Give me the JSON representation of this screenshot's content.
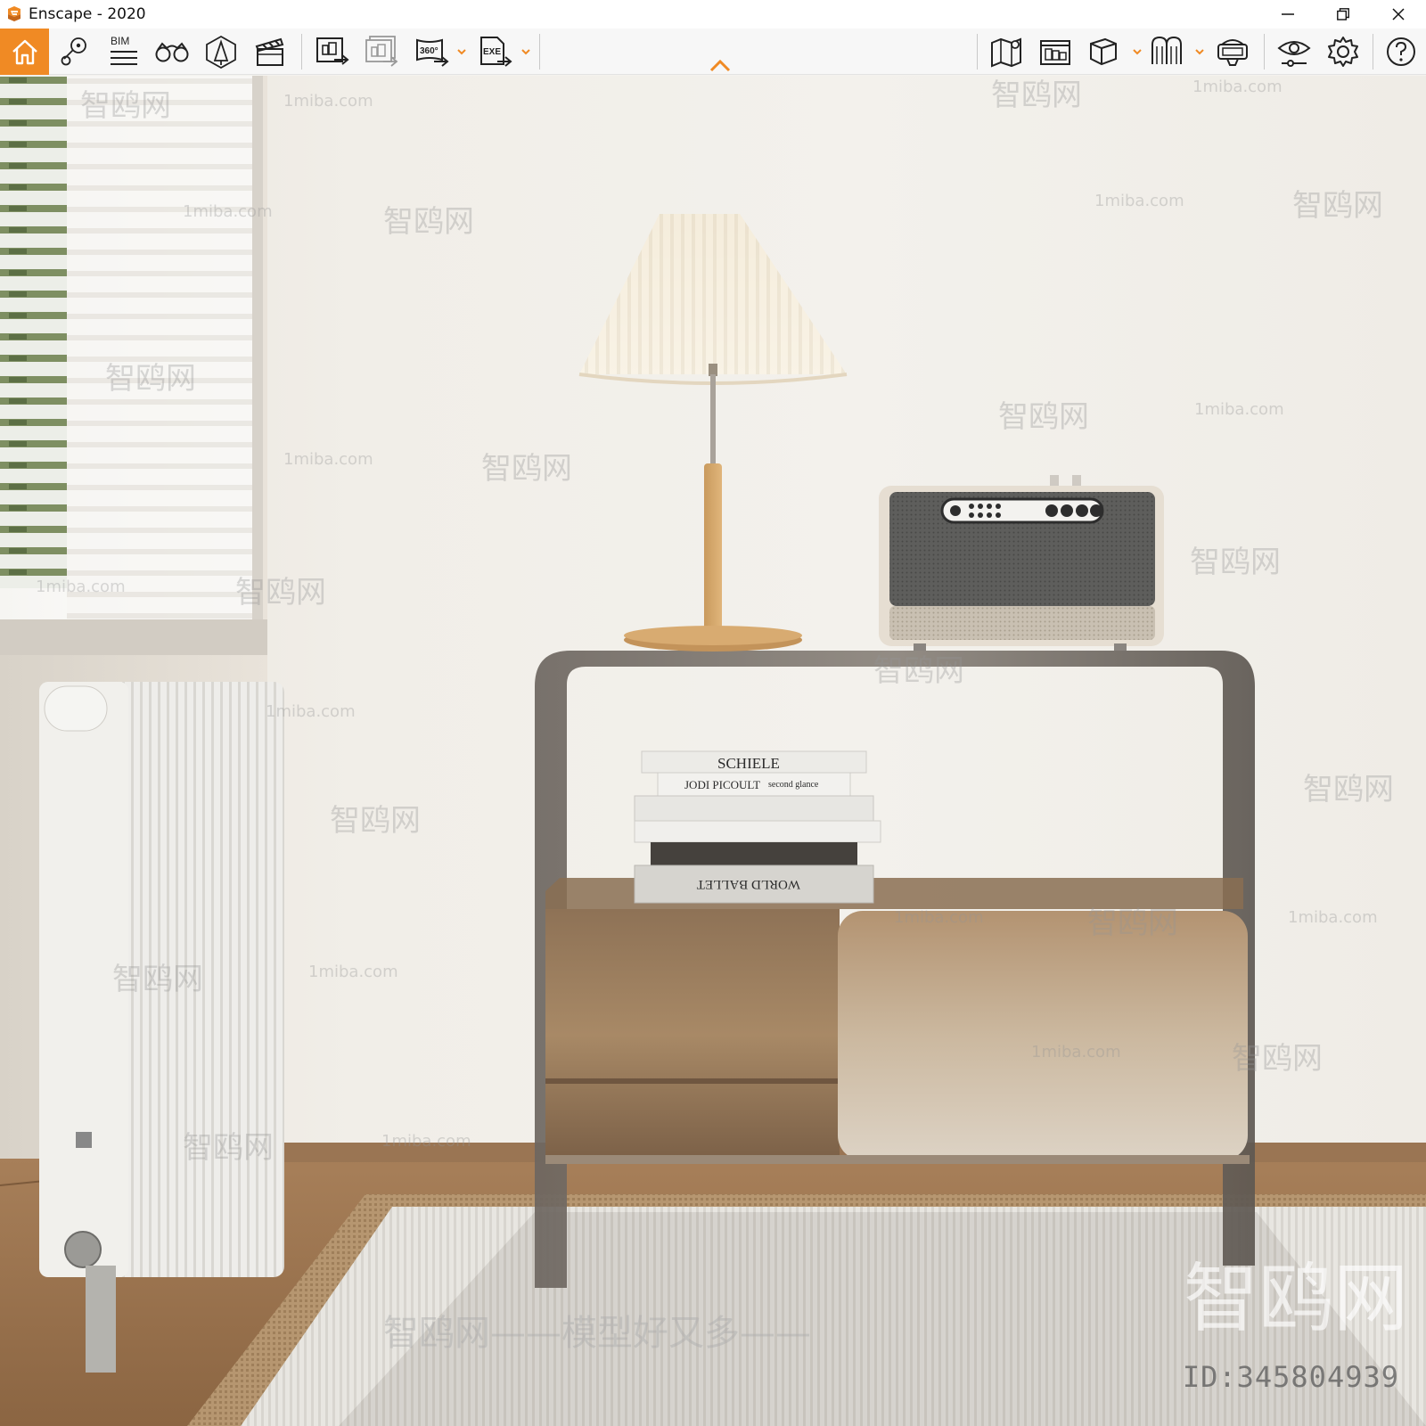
{
  "window": {
    "title": "Enscape - 2020",
    "controls": [
      "minimize",
      "restore",
      "close"
    ]
  },
  "toolbar": {
    "left_tools": [
      {
        "name": "home",
        "icon": "home-icon",
        "active": true
      },
      {
        "name": "views",
        "icon": "map-pin-views-icon"
      },
      {
        "name": "bim",
        "icon": "bim-list-icon",
        "label": "BIM"
      },
      {
        "name": "binoculars",
        "icon": "binoculars-icon"
      },
      {
        "name": "objects",
        "icon": "asset-library-icon"
      },
      {
        "name": "video-editor",
        "icon": "clapperboard-icon"
      },
      {
        "name": "render",
        "icon": "render-screenshot-icon"
      },
      {
        "name": "batch-render",
        "icon": "batch-render-icon"
      },
      {
        "name": "panorama",
        "icon": "panorama-360-icon",
        "label": "360°"
      },
      {
        "name": "exe-export",
        "icon": "exe-export-icon",
        "label": "EXE"
      }
    ],
    "right_tools": [
      {
        "name": "map",
        "icon": "map-icon"
      },
      {
        "name": "view-management",
        "icon": "view-management-icon"
      },
      {
        "name": "cube-view",
        "icon": "cube-icon"
      },
      {
        "name": "collaboration",
        "icon": "collaboration-icon"
      },
      {
        "name": "vr-headset",
        "icon": "vr-headset-icon"
      },
      {
        "name": "visual-settings",
        "icon": "eye-settings-icon"
      },
      {
        "name": "settings",
        "icon": "gear-icon"
      },
      {
        "name": "help",
        "icon": "help-icon"
      }
    ],
    "accent_color": "#f08a24",
    "collapse_icon": "chevron-up-icon"
  },
  "render": {
    "books": {
      "top_title": "SCHIELE",
      "second_author": "JODI PICOULT",
      "second_title": "second glance",
      "bottom_title": "WORLD BALLET"
    },
    "watermark_brand": "智鸥网",
    "watermark_url": "1miba.com",
    "watermark_slogan": "智鸥网——模型好又多——",
    "id_label": "ID:345804939"
  }
}
